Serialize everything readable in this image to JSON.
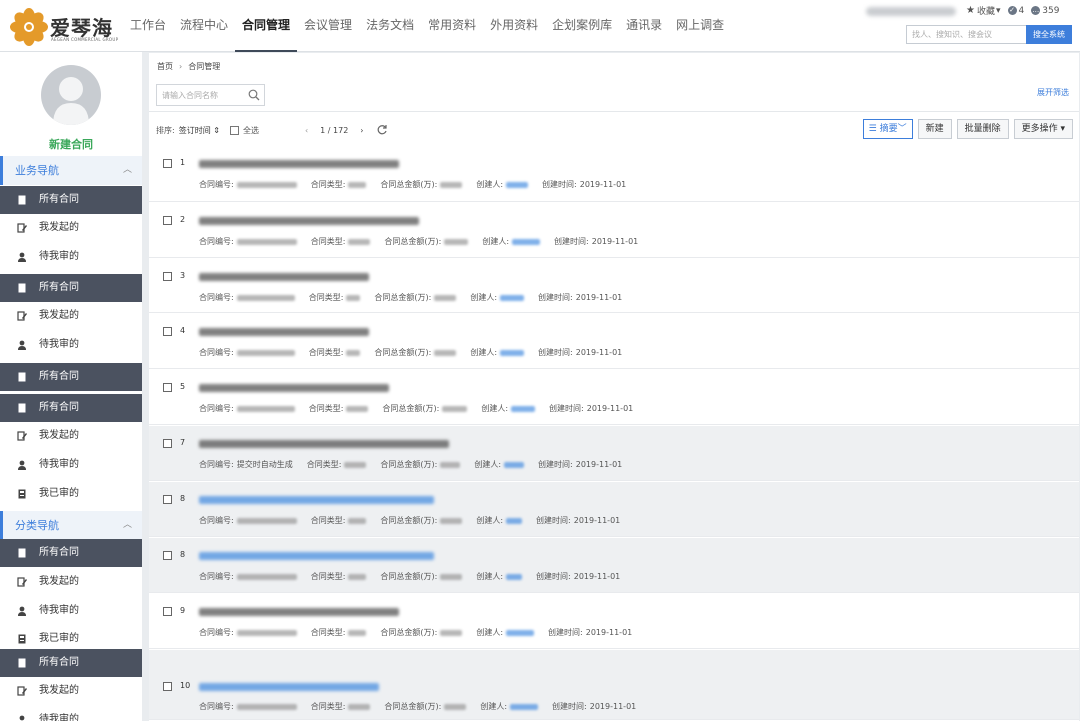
{
  "brand": {
    "name_cn": "爱琴海",
    "name_en": "AEGEAN COMMERCIAL GROUP",
    "colors": {
      "orange": "#e49a2a",
      "accent": "#3d7edb",
      "sidebar_active": "#4b5260",
      "new_green": "#3aa85a"
    }
  },
  "nav": {
    "items": [
      "工作台",
      "流程中心",
      "合同管理",
      "会议管理",
      "法务文档",
      "常用资料",
      "外用资料",
      "企划案例库",
      "通讯录",
      "网上调查"
    ],
    "active_index": 2
  },
  "topright": {
    "favorites_label": "收藏",
    "badge_count": "4",
    "message_count": "359",
    "search_placeholder": "找人、搜知识、搜会议",
    "search_button": "搜全系统"
  },
  "sidebar": {
    "new_label": "新建合同",
    "sections": [
      {
        "label": "业务导航",
        "caret": "︿"
      },
      {
        "label": "分类导航",
        "caret": "︿"
      }
    ],
    "items": [
      {
        "label": "所有合同",
        "icon": "document-icon",
        "active": true
      },
      {
        "label": "我发起的",
        "icon": "edit-icon",
        "active": false
      },
      {
        "label": "待我审的",
        "icon": "user-icon",
        "active": false
      },
      {
        "label": "所有合同",
        "icon": "document-icon",
        "active": true
      },
      {
        "label": "我发起的",
        "icon": "edit-icon",
        "active": false
      },
      {
        "label": "待我审的",
        "icon": "user-icon",
        "active": false
      },
      {
        "label": "所有合同",
        "icon": "document-icon",
        "active": true
      },
      {
        "label": "所有合同",
        "icon": "document-icon",
        "active": true
      },
      {
        "label": "我发起的",
        "icon": "edit-icon",
        "active": false
      },
      {
        "label": "待我审的",
        "icon": "user-icon",
        "active": false
      },
      {
        "label": "我已审的",
        "icon": "archive-icon",
        "active": false
      },
      {
        "label": "所有合同",
        "icon": "document-icon",
        "active": true
      },
      {
        "label": "我发起的",
        "icon": "edit-icon",
        "active": false
      },
      {
        "label": "待我审的",
        "icon": "user-icon",
        "active": false
      },
      {
        "label": "我已审的",
        "icon": "archive-icon",
        "active": false
      },
      {
        "label": "所有合同",
        "icon": "document-icon",
        "active": true
      },
      {
        "label": "我发起的",
        "icon": "edit-icon",
        "active": false
      },
      {
        "label": "待我审的",
        "icon": "user-icon",
        "active": false
      }
    ]
  },
  "main": {
    "breadcrumb": [
      "首页",
      "合同管理"
    ],
    "search_placeholder": "请输入合同名称",
    "expand_filter": "展开筛选",
    "toolbar": {
      "sort_label": "排序:",
      "sort_value": "签订时间 ⇕",
      "select_all": "全选",
      "page": "1 / 172",
      "view_select": "☰ 摘要﹀",
      "buttons": [
        "新建",
        "批量删除",
        "更多操作 ▾"
      ]
    },
    "labels": {
      "no": "合同编号:",
      "type": "合同类型:",
      "amount": "合同总金额(万):",
      "creator": "创建人:",
      "created": "创建时间:"
    },
    "rows": [
      {
        "num": "1",
        "created": "2019-11-01",
        "no": "",
        "link": false,
        "shade": false
      },
      {
        "num": "2",
        "created": "2019-11-01",
        "no": "",
        "link": false,
        "shade": false
      },
      {
        "num": "3",
        "created": "2019-11-01",
        "no": "",
        "link": false,
        "shade": false
      },
      {
        "num": "4",
        "created": "2019-11-01",
        "no": "",
        "link": false,
        "shade": false
      },
      {
        "num": "5",
        "created": "2019-11-01",
        "no": "",
        "link": false,
        "shade": false
      },
      {
        "num": "7",
        "created": "2019-11-01",
        "no": "提交时自动生成",
        "link": false,
        "shade": true
      },
      {
        "num": "8",
        "created": "2019-11-01",
        "no": "",
        "link": true,
        "shade": true
      },
      {
        "num": "8",
        "created": "2019-11-01",
        "no": "",
        "link": true,
        "shade": true
      },
      {
        "num": "9",
        "created": "2019-11-01",
        "no": "",
        "link": false,
        "shade": false
      },
      {
        "num": "10",
        "created": "2019-11-01",
        "no": "",
        "link": true,
        "shade": true
      }
    ]
  }
}
